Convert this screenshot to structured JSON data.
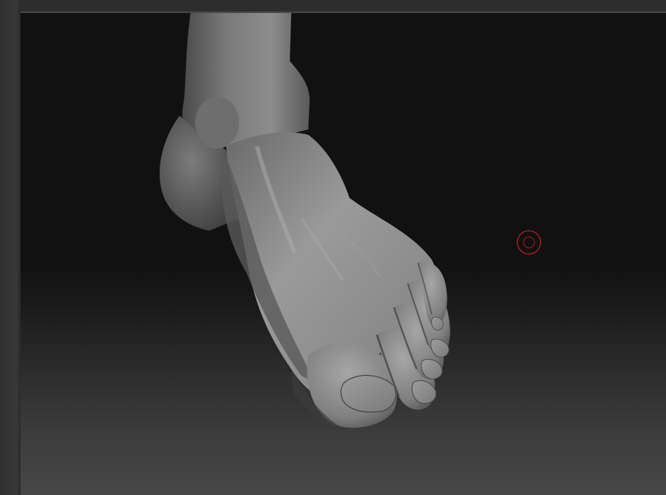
{
  "app": {
    "accent_color": "#c42020",
    "viewport_background_top": "#111111",
    "viewport_background_bottom": "#474747"
  },
  "viewport": {
    "model": {
      "subject": "sculpted-foot-model",
      "material": "matcap-gray"
    },
    "brush_cursor": {
      "icon": "brush-ring-icon",
      "color": "#c42020"
    }
  }
}
